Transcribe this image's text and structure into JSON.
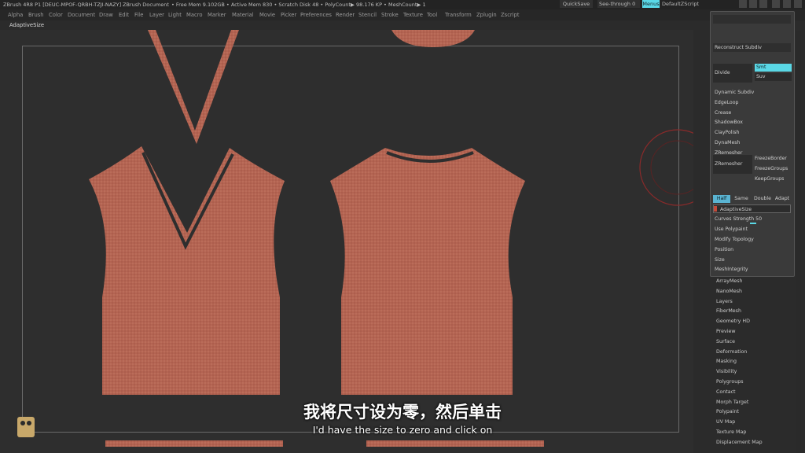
{
  "titlebar": {
    "app": "ZBrush 4R8 P1 [DEUC-MPOF-QRBH-TZJI-NAZY]",
    "doc": "ZBrush Document",
    "mem": "• Free Mem 9.102GB • Active Mem 830 • Scratch Disk 48 • PolyCount▶ 98.176 KP • MeshCount▶ 1",
    "quicksave": "QuickSave",
    "seethrough": "See-through  0",
    "menus": "Menus",
    "defaultscript": "DefaultZScript"
  },
  "menubar": [
    "Alpha",
    "Brush",
    "Color",
    "Document",
    "Draw",
    "Edit",
    "File",
    "Layer",
    "Light",
    "Macro",
    "Marker",
    "Material",
    "Movie",
    "Picker",
    "Preferences",
    "Render",
    "Stencil",
    "Stroke",
    "Texture",
    "Tool",
    "Transform",
    "Zplugin",
    "Zscript"
  ],
  "toolrow": {
    "label": "AdaptiveSize"
  },
  "panel": {
    "reconstruct": "Reconstruct Subdiv",
    "divide": "Divide",
    "smt": "Smt",
    "suv": "Suv",
    "items": [
      "Dynamic Subdiv",
      "EdgeLoop",
      "Crease",
      "ShadowBox",
      "ClayPolish",
      "DynaMesh",
      "ZRemesher"
    ],
    "zremesher": "ZRemesher",
    "freeze_border": "FreezeBorder",
    "freeze_groups": "FreezeGroups",
    "keep_groups": "KeepGroups",
    "half": "Half",
    "same": "Same",
    "double": "Double",
    "adapt": "Adapt",
    "adaptive_size": "AdaptiveSize",
    "curves_strength": "Curves Strength 50",
    "use_polypaint": "Use Polypaint",
    "bottom_items": [
      "Modify Topology",
      "Position",
      "Size",
      "MeshIntegrity"
    ]
  },
  "lower_list": [
    "ArrayMesh",
    "NanoMesh",
    "Layers",
    "FiberMesh",
    "Geometry HD",
    "Preview",
    "Surface",
    "Deformation",
    "Masking",
    "Visibility",
    "Polygroups",
    "Contact",
    "Morph Target",
    "Polypaint",
    "UV Map",
    "Texture Map",
    "Displacement Map"
  ],
  "subtitle": {
    "cn": "我将尺寸设为零，然后单击",
    "en": "I'd have the size to zero and click on"
  },
  "colors": {
    "fabric": "#b46452",
    "accent": "#5ad8e6",
    "selected": "#5ab4d2"
  }
}
